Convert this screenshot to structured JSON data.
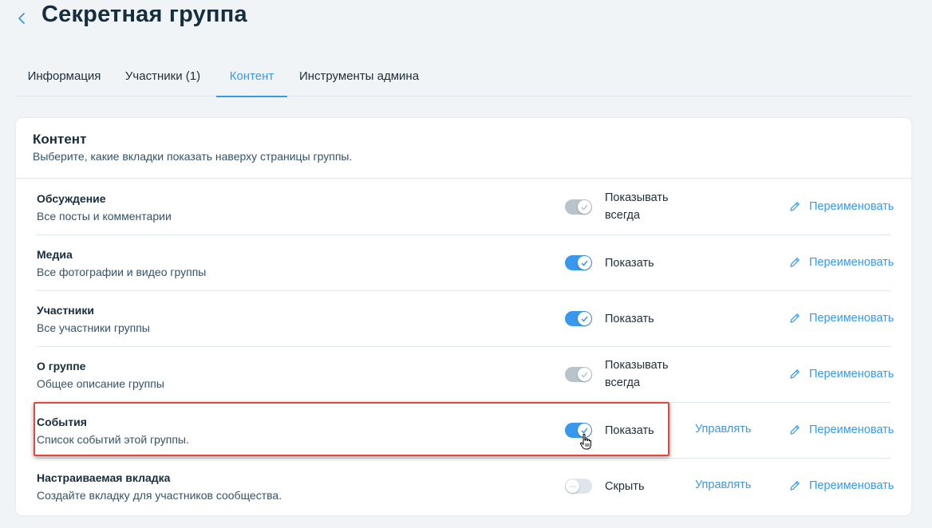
{
  "header": {
    "title": "Секретная группа",
    "back_icon": "chevron-left-icon"
  },
  "tabs": [
    {
      "label": "Информация",
      "active": false
    },
    {
      "label": "Участники (1)",
      "active": false
    },
    {
      "label": "Контент",
      "active": true
    },
    {
      "label": "Инструменты админа",
      "active": false
    }
  ],
  "content": {
    "title": "Контент",
    "subtitle": "Выберите, какие вкладки показать наверху страницы группы.",
    "rows": [
      {
        "name": "Обсуждение",
        "description": "Все посты и комментарии",
        "toggle": "locked",
        "status_line1": "Показывать",
        "status_line2": "всегда",
        "manage": "",
        "rename": "Переименовать"
      },
      {
        "name": "Медиа",
        "description": "Все фотографии и видео группы",
        "toggle": "on",
        "status": "Показать",
        "manage": "",
        "rename": "Переименовать"
      },
      {
        "name": "Участники",
        "description": "Все участники группы",
        "toggle": "on",
        "status": "Показать",
        "manage": "",
        "rename": "Переименовать"
      },
      {
        "name": "О группе",
        "description": "Общее описание группы",
        "toggle": "locked",
        "status_line1": "Показывать",
        "status_line2": "всегда",
        "manage": "",
        "rename": "Переименовать"
      },
      {
        "name": "События",
        "description": "Список событий этой группы.",
        "toggle": "on",
        "status": "Показать",
        "manage": "Управлять",
        "rename": "Переименовать"
      },
      {
        "name": "Настраиваемая вкладка",
        "description": "Создайте вкладку для участников сообщества.",
        "toggle": "off",
        "status": "Скрыть",
        "manage": "Управлять",
        "rename": "Переименовать"
      }
    ]
  },
  "colors": {
    "accent": "#3899ec",
    "highlight": "#e8463d",
    "background": "#f0f4f7"
  },
  "icons": [
    "chevron-left-icon",
    "check-icon",
    "pencil-icon",
    "hand-cursor-icon"
  ]
}
